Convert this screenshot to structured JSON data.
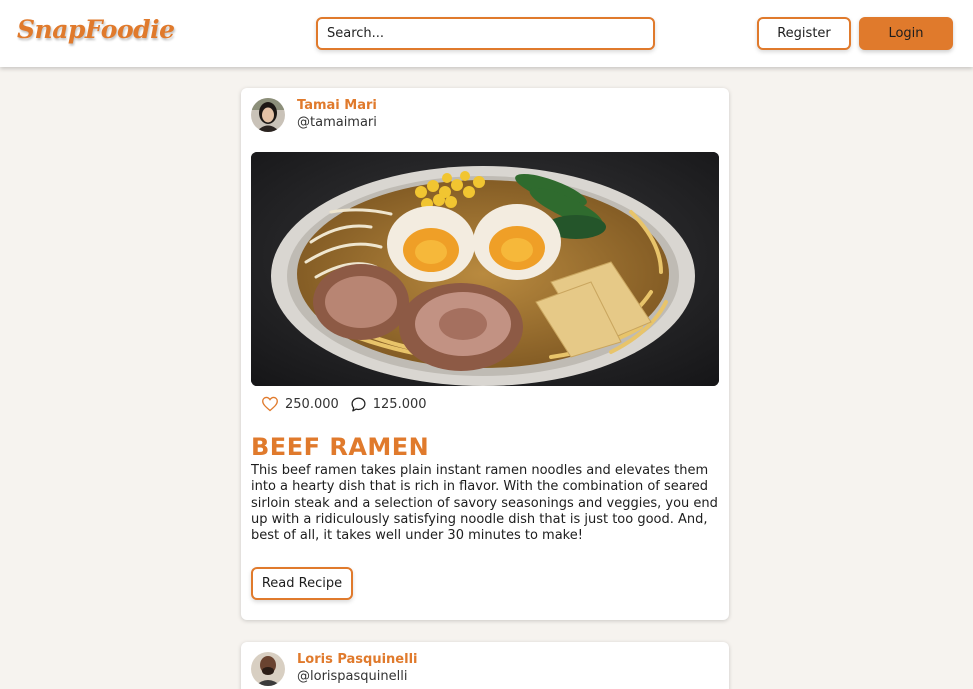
{
  "header": {
    "logo": "SnapFoodie",
    "search_placeholder": "Search...",
    "register_label": "Register",
    "login_label": "Login"
  },
  "colors": {
    "accent": "#e07a2c",
    "background": "#f6f3ef",
    "card": "#ffffff"
  },
  "posts": [
    {
      "author_name": "Tamai Mari",
      "author_handle": "@tamaimari",
      "photo": "beef-ramen-bowl",
      "likes": "250.000",
      "comments": "125.000",
      "title": "BEEF RAMEN",
      "description": "This beef ramen takes plain instant ramen noodles and elevates them into a hearty dish that is rich in flavor. With the combination of seared sirloin steak and a selection of savory seasonings and veggies, you end up with a ridiculously satisfying noodle dish that is just too good. And, best of all, it takes well under 30 minutes to make!",
      "read_label": "Read Recipe"
    },
    {
      "author_name": "Loris Pasquinelli",
      "author_handle": "@lorispasquinelli"
    }
  ],
  "icons": {
    "like": "heart-icon",
    "comment": "comment-icon"
  }
}
